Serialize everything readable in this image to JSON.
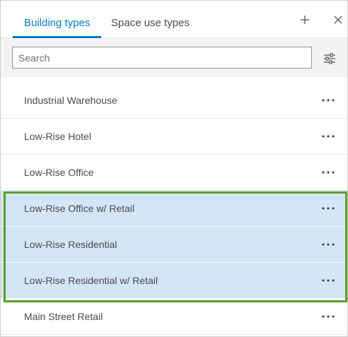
{
  "tabs": [
    {
      "label": "Building types",
      "active": true
    },
    {
      "label": "Space use types",
      "active": false
    }
  ],
  "header": {
    "add_icon": "plus-icon",
    "close_icon": "close-icon"
  },
  "search": {
    "placeholder": "Search",
    "value": ""
  },
  "toolbar": {
    "filter_icon": "filter-sliders-icon"
  },
  "list": {
    "items": [
      {
        "label": "Industrial Warehouse",
        "selected": false
      },
      {
        "label": "Low-Rise Hotel",
        "selected": false
      },
      {
        "label": "Low-Rise Office",
        "selected": false
      },
      {
        "label": "Low-Rise Office w/ Retail",
        "selected": true
      },
      {
        "label": "Low-Rise Residential",
        "selected": true
      },
      {
        "label": "Low-Rise Residential w/ Retail",
        "selected": true
      },
      {
        "label": "Main Street Retail",
        "selected": false
      }
    ],
    "more_icon": "ellipsis-icon"
  },
  "colors": {
    "accent": "#007ac2",
    "selected_row": "#d3e6f6",
    "highlight_outline": "#5aa02c"
  }
}
